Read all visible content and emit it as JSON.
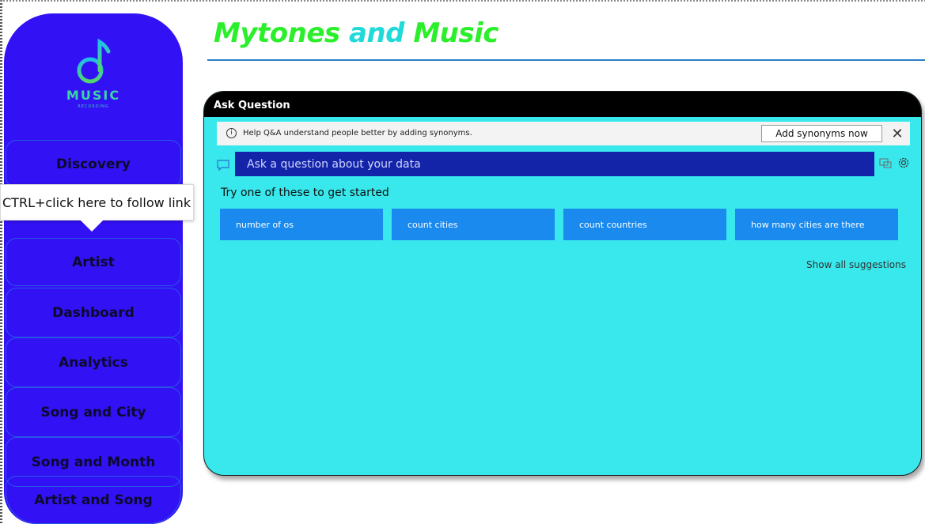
{
  "header": {
    "title_part1": "Mytones",
    "title_part2": "and",
    "title_part3": "Music"
  },
  "logo": {
    "word": "MUSIC",
    "sub": "RECORDING"
  },
  "tooltip": {
    "text": "CTRL+click here to follow link"
  },
  "sidebar": {
    "items": [
      {
        "label": "Discovery"
      },
      {
        "label": "Artist"
      },
      {
        "label": "Dashboard"
      },
      {
        "label": "Analytics"
      },
      {
        "label": "Song and City"
      },
      {
        "label": "Song and Month"
      },
      {
        "label": "Artist and Song"
      }
    ]
  },
  "qa": {
    "title": "Ask Question",
    "synonyms_message": "Help Q&A understand people better by adding synonyms.",
    "synonyms_button": "Add synonyms now",
    "close_glyph": "✕",
    "input_placeholder": "Ask a question about your data",
    "try_text": "Try one of these to get started",
    "suggestions": [
      {
        "label": "number of os"
      },
      {
        "label": "count cities"
      },
      {
        "label": "count countries"
      },
      {
        "label": "how many cities are there"
      }
    ],
    "show_all": "Show all suggestions"
  },
  "colors": {
    "sidebar_bg": "#3311f5",
    "card_bg": "#38e8ec",
    "input_bg": "#1424a8",
    "suggestion_bg": "#1a8aef",
    "title_green": "#2bef2b",
    "title_cyan": "#20d9d9"
  }
}
